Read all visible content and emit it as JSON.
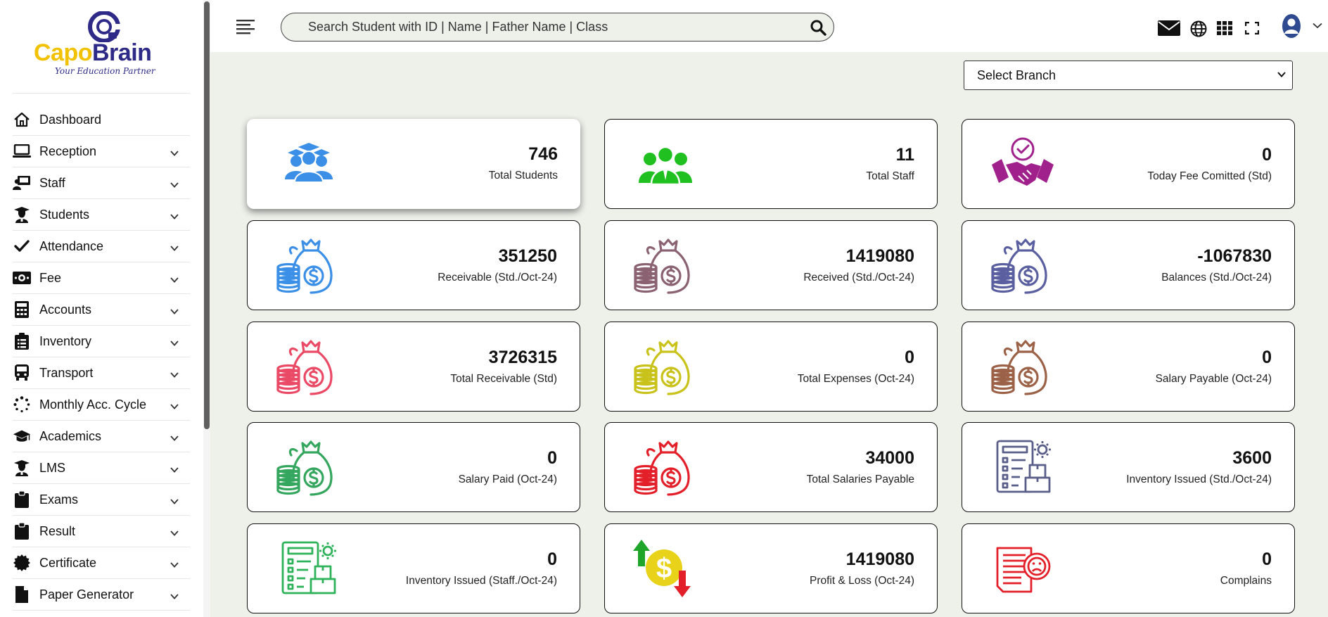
{
  "brand": {
    "name_part1": "Capo",
    "name_part2": "Brain",
    "tagline": "Your Education Partner",
    "color_primary": "#2e2a88",
    "color_accent": "#f2c200"
  },
  "sidebar": {
    "items": [
      {
        "label": "Dashboard",
        "icon": "home-icon",
        "has_submenu": false
      },
      {
        "label": "Reception",
        "icon": "laptop-icon",
        "has_submenu": true
      },
      {
        "label": "Staff",
        "icon": "staff-board-icon",
        "has_submenu": true
      },
      {
        "label": "Students",
        "icon": "graduate-icon",
        "has_submenu": true
      },
      {
        "label": "Attendance",
        "icon": "checkmark-icon",
        "has_submenu": true
      },
      {
        "label": "Fee",
        "icon": "money-icon",
        "has_submenu": true
      },
      {
        "label": "Accounts",
        "icon": "calculator-icon",
        "has_submenu": true
      },
      {
        "label": "Inventory",
        "icon": "clipboard-list-icon",
        "has_submenu": true
      },
      {
        "label": "Transport",
        "icon": "bus-icon",
        "has_submenu": true
      },
      {
        "label": "Monthly Acc. Cycle",
        "icon": "spinner-icon",
        "has_submenu": true
      },
      {
        "label": "Academics",
        "icon": "graduation-cap-icon",
        "has_submenu": true
      },
      {
        "label": "LMS",
        "icon": "graduate-icon",
        "has_submenu": true
      },
      {
        "label": "Exams",
        "icon": "clipboard-icon",
        "has_submenu": true
      },
      {
        "label": "Result",
        "icon": "clipboard-icon",
        "has_submenu": true
      },
      {
        "label": "Certificate",
        "icon": "certificate-icon",
        "has_submenu": true
      },
      {
        "label": "Paper Generator",
        "icon": "file-icon",
        "has_submenu": true
      }
    ]
  },
  "search": {
    "placeholder": "Search Student with ID | Name | Father Name | Class",
    "value": ""
  },
  "branch_select": {
    "selected": "Select Branch"
  },
  "cards": [
    {
      "value": "746",
      "label": "Total Students",
      "icon": "students-icon",
      "color": "#3b8fe6"
    },
    {
      "value": "11",
      "label": "Total Staff",
      "icon": "staff-group-icon",
      "color": "#1fc01f"
    },
    {
      "value": "0",
      "label": "Today Fee Comitted (Std)",
      "icon": "handshake-icon",
      "color": "#a0208c"
    },
    {
      "value": "351250",
      "label": "Receivable (Std./Oct-24)",
      "icon": "money-bag-icon",
      "color": "#3b8fe6"
    },
    {
      "value": "1419080",
      "label": "Received (Std./Oct-24)",
      "icon": "money-bag-icon",
      "color": "#8a6272"
    },
    {
      "value": "-1067830",
      "label": "Balances (Std./Oct-24)",
      "icon": "money-bag-icon",
      "color": "#5a5fa0"
    },
    {
      "value": "3726315",
      "label": "Total Receivable (Std)",
      "icon": "money-bag-icon",
      "color": "#ea4a66"
    },
    {
      "value": "0",
      "label": "Total Expenses (Oct-24)",
      "icon": "money-bag-icon",
      "color": "#c9c21a"
    },
    {
      "value": "0",
      "label": "Salary Payable (Oct-24)",
      "icon": "money-bag-icon",
      "color": "#9c6248"
    },
    {
      "value": "0",
      "label": "Salary Paid (Oct-24)",
      "icon": "money-bag-icon",
      "color": "#34a65e"
    },
    {
      "value": "34000",
      "label": "Total Salaries Payable",
      "icon": "money-bag-icon",
      "color": "#e3202a"
    },
    {
      "value": "3600",
      "label": "Inventory Issued (Std./Oct-24)",
      "icon": "inventory-icon",
      "color": "#5a5f8a"
    },
    {
      "value": "0",
      "label": "Inventory Issued (Staff./Oct-24)",
      "icon": "inventory-icon",
      "color": "#2fb35a"
    },
    {
      "value": "1419080",
      "label": "Profit & Loss (Oct-24)",
      "icon": "profit-loss-icon",
      "color": "#e8d21a"
    },
    {
      "value": "0",
      "label": "Complains",
      "icon": "complaint-icon",
      "color": "#e3202a"
    }
  ]
}
